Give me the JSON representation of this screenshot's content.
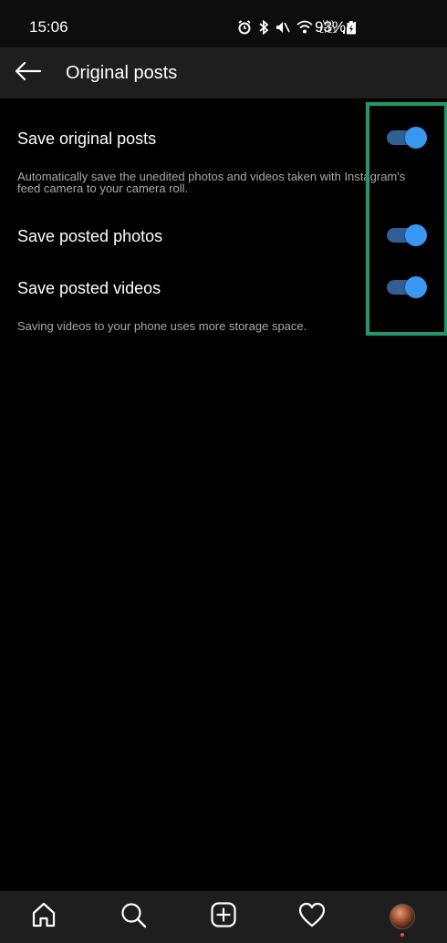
{
  "status_bar": {
    "time": "15:06",
    "lte_top": "Vo)",
    "lte_bottom": "LTE1",
    "battery": "93%"
  },
  "header": {
    "title": "Original posts"
  },
  "settings": {
    "save_original_posts": {
      "label": "Save original posts",
      "description": "Automatically save the unedited photos and videos taken with Instagram's feed camera to your camera roll.",
      "enabled": true
    },
    "save_posted_photos": {
      "label": "Save posted photos",
      "enabled": true
    },
    "save_posted_videos": {
      "label": "Save posted videos",
      "description": "Saving videos to your phone uses more storage space.",
      "enabled": true
    }
  },
  "bottom_nav": {
    "items": [
      "home-icon",
      "search-icon",
      "add-post-icon",
      "activity-heart-icon",
      "profile-avatar"
    ]
  },
  "colors": {
    "toggle_on": "#3897f0",
    "toggle_track_on": "#2f5f94",
    "highlight": "#1a9b68",
    "notification": "#ed4956"
  }
}
